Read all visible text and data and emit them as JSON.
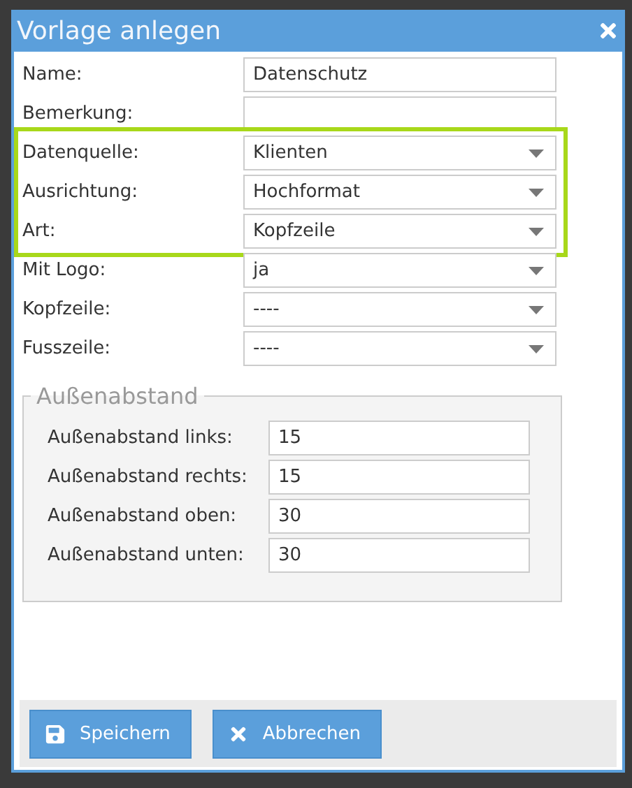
{
  "dialog": {
    "title": "Vorlage anlegen"
  },
  "fields": [
    {
      "label": "Name:",
      "kind": "text",
      "value": "Datenschutz",
      "highlighted": false
    },
    {
      "label": "Bemerkung:",
      "kind": "text",
      "highlighted": false
    },
    {
      "label": "Datenquelle:",
      "kind": "select",
      "value": "Klienten",
      "highlighted": true
    },
    {
      "label": "Ausrichtung:",
      "kind": "select",
      "value": "Hochformat",
      "highlighted": true
    },
    {
      "label": "Art:",
      "kind": "select",
      "value": "Kopfzeile",
      "highlighted": true
    },
    {
      "label": "Mit Logo:",
      "kind": "select",
      "value": "ja",
      "highlighted": false
    },
    {
      "label": "Kopfzeile:",
      "kind": "select",
      "value": "----",
      "highlighted": false
    },
    {
      "label": "Fusszeile:",
      "kind": "select",
      "value": "----",
      "highlighted": false
    }
  ],
  "margins": {
    "legend": "Außenabstand",
    "fields": [
      {
        "label": "Außenabstand links:",
        "value": "15"
      },
      {
        "label": "Außenabstand rechts:",
        "value": "15"
      },
      {
        "label": "Außenabstand oben:",
        "value": "30"
      },
      {
        "label": "Außenabstand unten:",
        "value": "30"
      }
    ]
  },
  "buttons": [
    {
      "label": "Speichern",
      "kind": "save"
    },
    {
      "label": "Abbrechen",
      "kind": "cancel"
    }
  ]
}
